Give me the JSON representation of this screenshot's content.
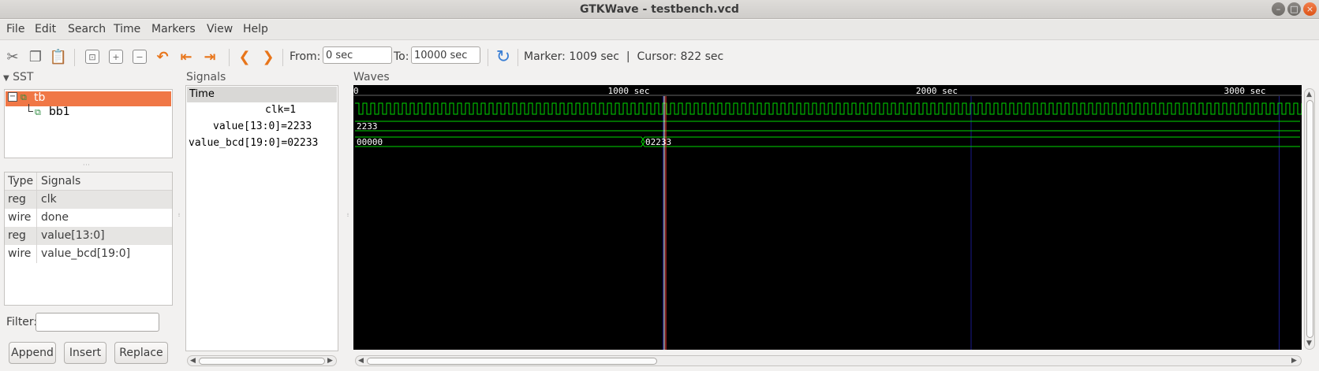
{
  "window": {
    "title": "GTKWave - testbench.vcd"
  },
  "menu": [
    "File",
    "Edit",
    "Search",
    "Time",
    "Markers",
    "View",
    "Help"
  ],
  "toolbar": {
    "from_label": "From:",
    "from_value": "0 sec",
    "to_label": "To:",
    "to_value": "10000 sec",
    "status": "Marker: 1009 sec  |  Cursor: 822 sec"
  },
  "sst": {
    "title": "SST",
    "tree": {
      "root": "tb",
      "child": "bb1"
    },
    "table_headers": {
      "type": "Type",
      "signals": "Signals"
    },
    "rows": [
      {
        "type": "reg",
        "name": "clk"
      },
      {
        "type": "wire",
        "name": "done"
      },
      {
        "type": "reg",
        "name": "value[13:0]"
      },
      {
        "type": "wire",
        "name": "value_bcd[19:0]"
      }
    ],
    "filter_label": "Filter:",
    "filter_value": "",
    "buttons": {
      "append": "Append",
      "insert": "Insert",
      "replace": "Replace"
    }
  },
  "signals": {
    "title": "Signals",
    "time_label": "Time",
    "items": [
      {
        "label": "clk=1"
      },
      {
        "label": "value[13:0]=2233"
      },
      {
        "label": "value_bcd[19:0]=02233"
      }
    ]
  },
  "waves": {
    "title": "Waves",
    "ruler": [
      "0",
      "1000 sec",
      "2000 sec",
      "3000 sec"
    ],
    "value_trace_label": "2233",
    "bcd_before": "00000",
    "bcd_after": "02233",
    "marker_time": 1009,
    "cursor_time": 822,
    "colors": {
      "background": "#000000",
      "trace": "#00d800",
      "marker": "#ff3b3b",
      "grid": "#1a1a8c"
    }
  }
}
